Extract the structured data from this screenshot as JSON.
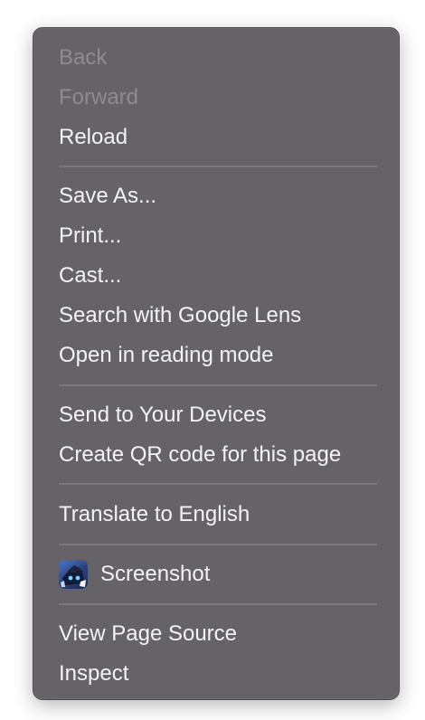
{
  "menu": {
    "back": "Back",
    "forward": "Forward",
    "reload": "Reload",
    "save_as": "Save As...",
    "print": "Print...",
    "cast": "Cast...",
    "search_lens": "Search with Google Lens",
    "reading_mode": "Open in reading mode",
    "send_devices": "Send to Your Devices",
    "qr_code": "Create QR code for this page",
    "translate": "Translate to English",
    "screenshot": "Screenshot",
    "view_source": "View Page Source",
    "inspect": "Inspect"
  },
  "icons": {
    "screenshot_extension": "screenshot-extension-icon"
  },
  "colors": {
    "menu_background": "#656268",
    "text": "#f4f3f6",
    "disabled_text": "#8e8b92",
    "separator": "#7b7880"
  }
}
